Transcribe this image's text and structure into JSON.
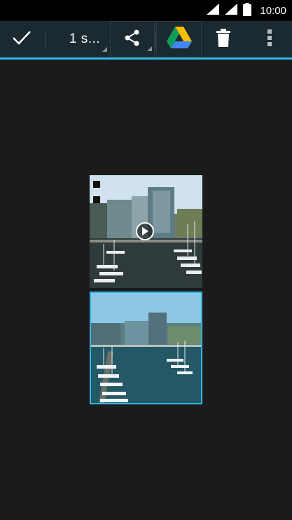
{
  "status_bar": {
    "time": "10:00",
    "icons": [
      "signal-wifi-icon",
      "signal-cellular-icon",
      "battery-icon"
    ]
  },
  "action_bar": {
    "done_icon": "check-icon",
    "selection_label": "1 s...",
    "share_icon": "share-icon",
    "drive_icon": "google-drive-icon",
    "delete_icon": "trash-icon",
    "overflow_icon": "more-vert-icon"
  },
  "gallery": {
    "items": [
      {
        "type": "video",
        "selected": false,
        "play_icon": "play-icon"
      },
      {
        "type": "photo",
        "selected": true
      }
    ]
  },
  "colors": {
    "accent": "#33b5e5",
    "action_bar_bg": "#1a2a30",
    "background": "#1b1b1b"
  }
}
